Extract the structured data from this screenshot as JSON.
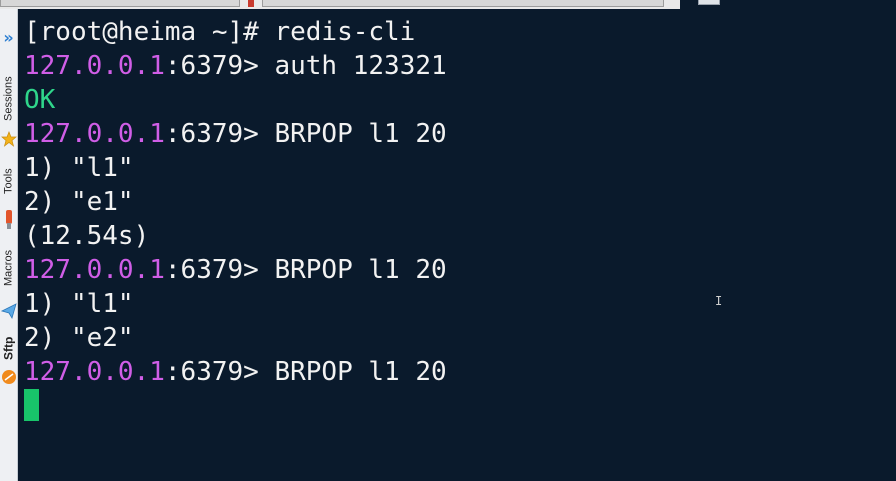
{
  "dock": {
    "items": [
      {
        "label": "Sessions",
        "icon": "sessions-icon"
      },
      {
        "label": "Tools",
        "icon": "star-icon"
      },
      {
        "label": "Macros",
        "icon": "tools-icon"
      },
      {
        "label": "Sftp",
        "icon": "sftp-icon"
      }
    ],
    "expand_icon": "expand-icon"
  },
  "terminal": {
    "lines": [
      {
        "text": "[root@heima ~]# redis-cli"
      },
      {
        "ip": "127.0.0.1",
        "rest": ":6379> auth 123321"
      },
      {
        "text": "OK"
      },
      {
        "ip": "127.0.0.1",
        "rest": ":6379> BRPOP l1 20"
      },
      {
        "text": "1) \"l1\""
      },
      {
        "text": "2) \"e1\""
      },
      {
        "text": "(12.54s)"
      },
      {
        "ip": "127.0.0.1",
        "rest": ":6379> BRPOP l1 20"
      },
      {
        "text": "1) \"l1\""
      },
      {
        "text": "2) \"e2\""
      },
      {
        "ip": "127.0.0.1",
        "rest": ":6379> BRPOP l1 20"
      }
    ],
    "mouse_cursor": "I",
    "colors": {
      "background": "#0a1a2c",
      "prompt_ip": "#d05ee7",
      "ok": "#2fd58b",
      "cursor": "#18c56a",
      "text": "#f2f2f2"
    }
  }
}
